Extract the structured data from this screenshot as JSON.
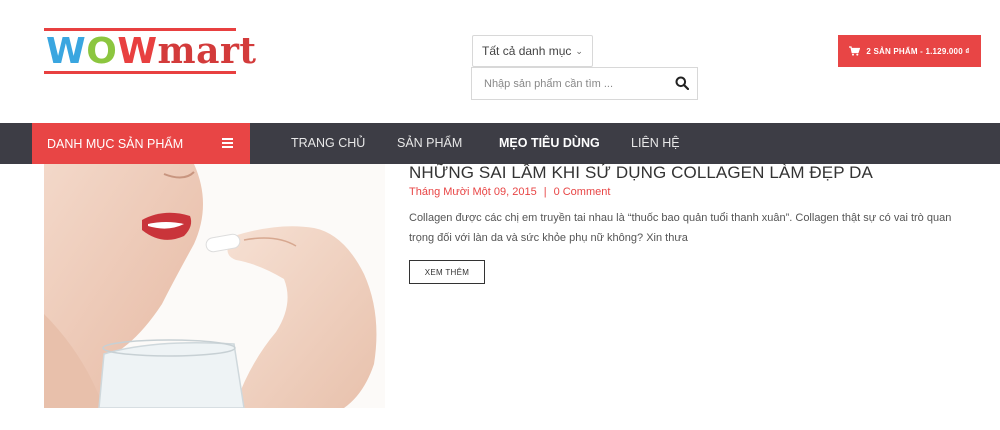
{
  "logo": {
    "w1": "W",
    "w2": "O",
    "w3": "W",
    "rest": "mart"
  },
  "header": {
    "category_select": "Tất cả danh mục",
    "search_placeholder": "Nhập sản phẩm cần tìm ...",
    "cart_label": "2 SẢN PHẨM - 1.129.000 ₫"
  },
  "nav": {
    "categories_label": "DANH MỤC SẢN PHẨM",
    "items": [
      {
        "label": "TRANG CHỦ",
        "active": false
      },
      {
        "label": "SẢN PHẨM",
        "active": false
      },
      {
        "label": "MẸO TIÊU DÙNG",
        "active": true
      },
      {
        "label": "LIÊN HỆ",
        "active": false
      }
    ]
  },
  "post": {
    "title": "NHỮNG SAI LẦM KHI SỬ DỤNG COLLAGEN LÀM ĐẸP DA",
    "date": "Tháng Mười Một 09, 2015",
    "separator": "|",
    "comments": "0 Comment",
    "excerpt": "Collagen được các chị em truyền tai nhau là “thuốc bao quản tuổi thanh xuân”. Collagen thật sự có vai trò quan trọng đối với làn da và sức khỏe phụ nữ không? Xin thưa",
    "read_more": "XEM THÊM"
  },
  "colors": {
    "accent": "#e84545",
    "nav_bg": "#3d3d45"
  }
}
